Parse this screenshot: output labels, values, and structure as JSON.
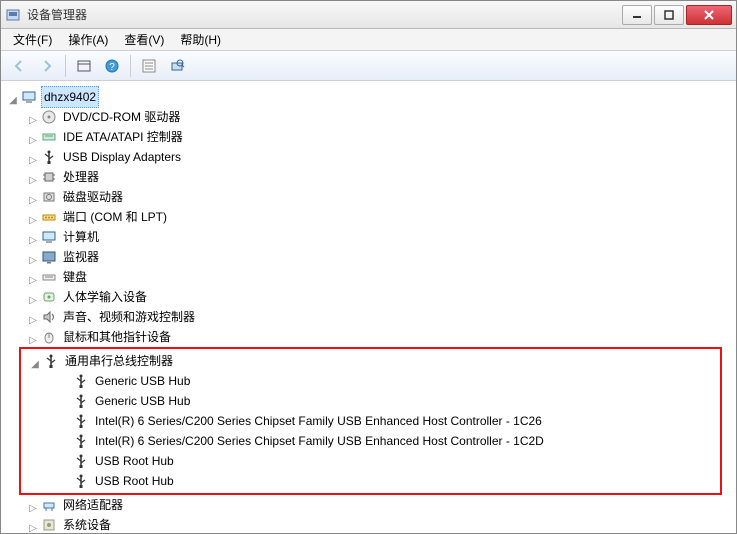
{
  "window": {
    "title": "设备管理器"
  },
  "menu": {
    "file": "文件(F)",
    "action": "操作(A)",
    "view": "查看(V)",
    "help": "帮助(H)"
  },
  "tree": {
    "root": "dhzx9402",
    "items": [
      {
        "label": "DVD/CD-ROM 驱动器",
        "icon": "disc"
      },
      {
        "label": "IDE ATA/ATAPI 控制器",
        "icon": "ide"
      },
      {
        "label": "USB Display Adapters",
        "icon": "usb"
      },
      {
        "label": "处理器",
        "icon": "cpu"
      },
      {
        "label": "磁盘驱动器",
        "icon": "hdd"
      },
      {
        "label": "端口 (COM 和 LPT)",
        "icon": "port"
      },
      {
        "label": "计算机",
        "icon": "pc"
      },
      {
        "label": "监视器",
        "icon": "monitor"
      },
      {
        "label": "键盘",
        "icon": "keyboard"
      },
      {
        "label": "人体学输入设备",
        "icon": "hid"
      },
      {
        "label": "声音、视频和游戏控制器",
        "icon": "sound"
      },
      {
        "label": "鼠标和其他指针设备",
        "icon": "mouse"
      }
    ],
    "usb_category": "通用串行总线控制器",
    "usb_children": [
      "Generic USB Hub",
      "Generic USB Hub",
      "Intel(R) 6 Series/C200 Series Chipset Family USB Enhanced Host Controller - 1C26",
      "Intel(R) 6 Series/C200 Series Chipset Family USB Enhanced Host Controller - 1C2D",
      "USB Root Hub",
      "USB Root Hub"
    ],
    "after": [
      {
        "label": "网络适配器",
        "icon": "net"
      },
      {
        "label": "系统设备",
        "icon": "sys"
      }
    ]
  }
}
